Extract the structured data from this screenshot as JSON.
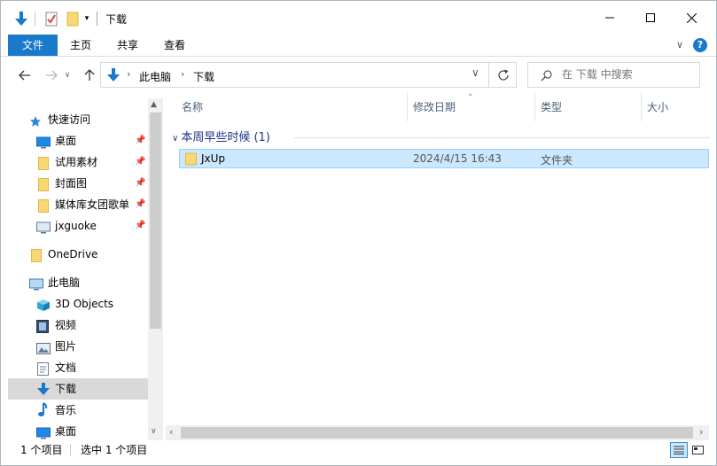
{
  "window": {
    "title": "下载"
  },
  "ribbon": {
    "tabs": [
      {
        "label": "文件"
      },
      {
        "label": "主页"
      },
      {
        "label": "共享"
      },
      {
        "label": "查看"
      }
    ],
    "chevron": "∨",
    "help": "?"
  },
  "address": {
    "segments": [
      "此电脑",
      "下载"
    ]
  },
  "search": {
    "placeholder": "在 下载 中搜索"
  },
  "sidebar": {
    "items": [
      {
        "label": "快速访问",
        "icon": "star-icon"
      },
      {
        "label": "桌面",
        "icon": "desktop-icon"
      },
      {
        "label": "试用素材",
        "icon": "folder-icon"
      },
      {
        "label": "封面图",
        "icon": "folder-icon"
      },
      {
        "label": "媒体库女团歌单",
        "icon": "folder-icon"
      },
      {
        "label": "jxguoke",
        "icon": "monitor-icon"
      },
      {
        "label": "OneDrive",
        "icon": "folder-icon"
      },
      {
        "label": "此电脑",
        "icon": "pc-icon"
      },
      {
        "label": "3D Objects",
        "icon": "cube-icon"
      },
      {
        "label": "视频",
        "icon": "video-icon"
      },
      {
        "label": "图片",
        "icon": "picture-icon"
      },
      {
        "label": "文档",
        "icon": "document-icon"
      },
      {
        "label": "下载",
        "icon": "download-icon"
      },
      {
        "label": "音乐",
        "icon": "music-icon"
      },
      {
        "label": "桌面",
        "icon": "desktop-icon"
      }
    ]
  },
  "columns": [
    {
      "label": "名称"
    },
    {
      "label": "修改日期"
    },
    {
      "label": "类型"
    },
    {
      "label": "大小"
    }
  ],
  "group": {
    "label": "本周早些时候 (1)"
  },
  "files": [
    {
      "name": "JxUp",
      "date": "2024/4/15 16:43",
      "type": "文件夹",
      "size": ""
    }
  ],
  "status": {
    "count": "1 个项目",
    "selected": "选中 1 个项目"
  },
  "colors": {
    "accent": "#1979ca",
    "selection": "#cce8ff",
    "folder": "#f8d775",
    "group_text": "#1e3287"
  }
}
